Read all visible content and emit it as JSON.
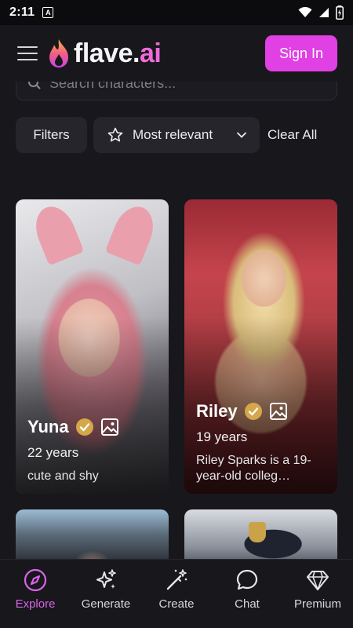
{
  "status_bar": {
    "time": "2:11",
    "notif_glyph": "A"
  },
  "header": {
    "logo_main": "flave.",
    "logo_accent": "ai",
    "sign_in_label": "Sign In"
  },
  "search": {
    "placeholder": "Search characters..."
  },
  "filters": {
    "filters_label": "Filters",
    "sort_label": "Most relevant",
    "clear_label": "Clear All"
  },
  "characters": [
    {
      "name": "Yuna",
      "age": "22 years",
      "description": "cute and shy"
    },
    {
      "name": "Riley",
      "age": "19 years",
      "description": "Riley Sparks is a 19-year-old colleg…"
    }
  ],
  "nav": [
    {
      "label": "Explore",
      "icon": "compass-icon",
      "active": true
    },
    {
      "label": "Generate",
      "icon": "sparkles-icon",
      "active": false
    },
    {
      "label": "Create",
      "icon": "magic-wand-icon",
      "active": false
    },
    {
      "label": "Chat",
      "icon": "chat-bubble-icon",
      "active": false
    },
    {
      "label": "Premium",
      "icon": "diamond-icon",
      "active": false
    }
  ],
  "colors": {
    "background": "#18171c",
    "accent": "#e040e4",
    "active_nav": "#d865e6",
    "verified_badge": "#d4a84a"
  }
}
